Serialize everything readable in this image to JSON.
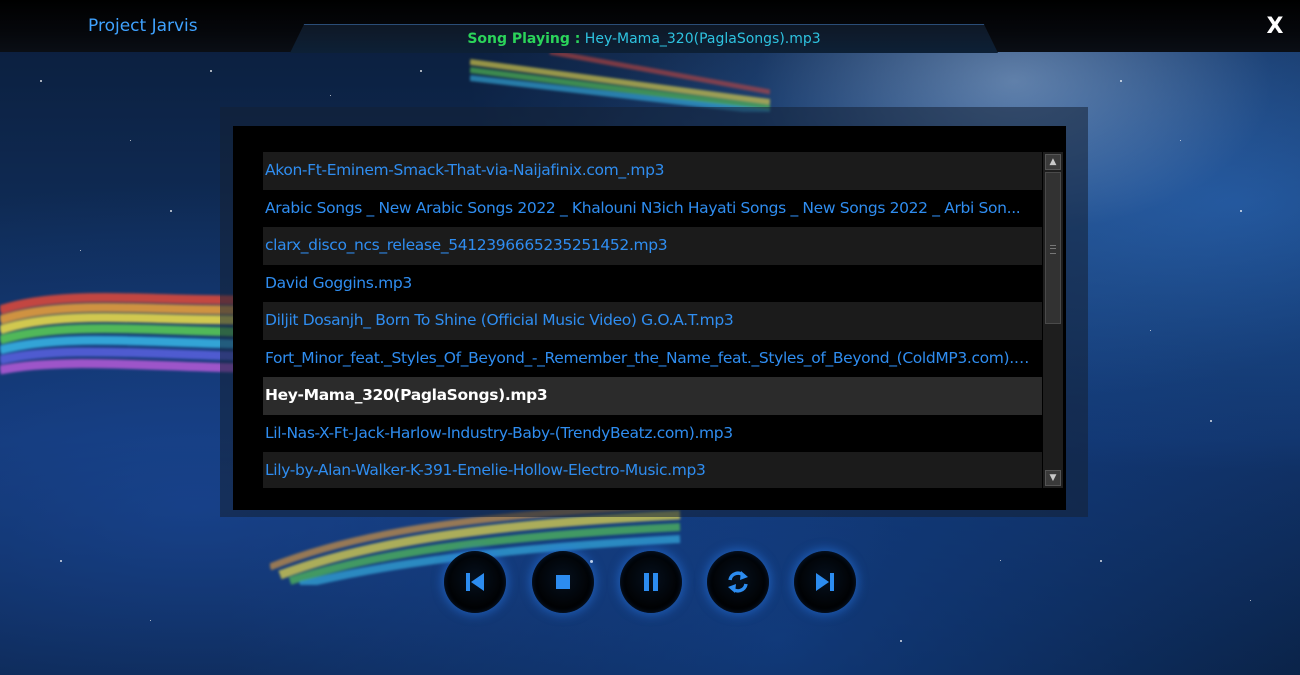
{
  "window": {
    "title": "Project Jarvis",
    "close_label": "X"
  },
  "now_playing": {
    "label": "Song Playing :",
    "value": "Hey-Mama_320(PaglaSongs).mp3"
  },
  "playlist": {
    "items": [
      "Akon-Ft-Eminem-Smack-That-via-Naijafinix.com_.mp3",
      "Arabic Songs _  New Arabic Songs 2022 _ Khalouni N3ich Hayati Songs _ New Songs 2022 _ Arbi Son...",
      "clarx_disco_ncs_release_5412396665235251452.mp3",
      "David Goggins.mp3",
      "Diljit Dosanjh_ Born To Shine (Official Music Video) G.O.A.T.mp3",
      "Fort_Minor_feat._Styles_Of_Beyond_-_Remember_the_Name_feat._Styles_of_Beyond_(ColdMP3.com).m...",
      "Hey-Mama_320(PaglaSongs).mp3",
      "Lil-Nas-X-Ft-Jack-Harlow-Industry-Baby-(TrendyBeatz.com).mp3",
      "Lily-by-Alan-Walker-K-391-Emelie-Hollow-Electro-Music.mp3"
    ],
    "selected_index": 6
  },
  "controls": [
    {
      "name": "previous-button",
      "icon": "skip-previous-icon"
    },
    {
      "name": "stop-button",
      "icon": "stop-icon"
    },
    {
      "name": "pause-button",
      "icon": "pause-icon"
    },
    {
      "name": "repeat-button",
      "icon": "repeat-icon"
    },
    {
      "name": "next-button",
      "icon": "skip-next-icon"
    }
  ],
  "colors": {
    "accent": "#3fa2ff",
    "icon_blue": "#2c8cf0",
    "label_green": "#2bd45a",
    "value_cyan": "#2ec3e0"
  }
}
